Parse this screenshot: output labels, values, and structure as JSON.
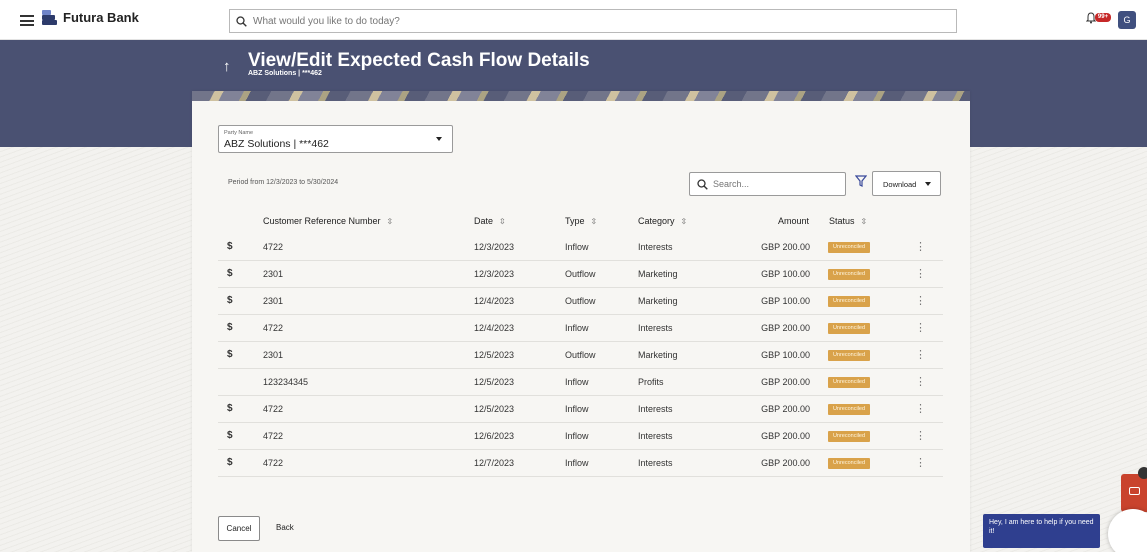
{
  "app": {
    "brand": "Futura Bank",
    "search_placeholder": "What would you like to do today?",
    "notification_badge": "99+",
    "avatar_initial": "G"
  },
  "header": {
    "title": "View/Edit Expected Cash Flow Details",
    "subtitle": "ABZ Solutions | ***462"
  },
  "filters": {
    "party_label": "Party Name",
    "party_value": "ABZ Solutions | ***462",
    "period": "Period from 12/3/2023 to 5/30/2024",
    "search_placeholder": "Search...",
    "download_label": "Download"
  },
  "table": {
    "columns": [
      "Customer Reference Number",
      "Date",
      "Type",
      "Category",
      "Amount",
      "Status"
    ],
    "rows": [
      {
        "icon": true,
        "ref": "4722",
        "date": "12/3/2023",
        "type": "Inflow",
        "category": "Interests",
        "amount": "GBP 200.00",
        "status": "Unreconciled"
      },
      {
        "icon": true,
        "ref": "2301",
        "date": "12/3/2023",
        "type": "Outflow",
        "category": "Marketing",
        "amount": "GBP 100.00",
        "status": "Unreconciled"
      },
      {
        "icon": true,
        "ref": "2301",
        "date": "12/4/2023",
        "type": "Outflow",
        "category": "Marketing",
        "amount": "GBP 100.00",
        "status": "Unreconciled"
      },
      {
        "icon": true,
        "ref": "4722",
        "date": "12/4/2023",
        "type": "Inflow",
        "category": "Interests",
        "amount": "GBP 200.00",
        "status": "Unreconciled"
      },
      {
        "icon": true,
        "ref": "2301",
        "date": "12/5/2023",
        "type": "Outflow",
        "category": "Marketing",
        "amount": "GBP 100.00",
        "status": "Unreconciled"
      },
      {
        "icon": false,
        "ref": "123234345",
        "date": "12/5/2023",
        "type": "Inflow",
        "category": "Profits",
        "amount": "GBP 200.00",
        "status": "Unreconciled"
      },
      {
        "icon": true,
        "ref": "4722",
        "date": "12/5/2023",
        "type": "Inflow",
        "category": "Interests",
        "amount": "GBP 200.00",
        "status": "Unreconciled"
      },
      {
        "icon": true,
        "ref": "4722",
        "date": "12/6/2023",
        "type": "Inflow",
        "category": "Interests",
        "amount": "GBP 200.00",
        "status": "Unreconciled"
      },
      {
        "icon": true,
        "ref": "4722",
        "date": "12/7/2023",
        "type": "Inflow",
        "category": "Interests",
        "amount": "GBP 200.00",
        "status": "Unreconciled"
      }
    ]
  },
  "actions": {
    "cancel_label": "Cancel",
    "back_label": "Back"
  },
  "chat": {
    "message": "Hey, I am here to help if you need it!"
  },
  "colors": {
    "header_band": "#4a5172",
    "status_badge": "#d9a24a",
    "chat_bubble": "#2f3f8f",
    "chat_button": "#c9432d"
  },
  "icons": [
    "menu-icon",
    "bank-logo-icon",
    "search-icon",
    "bell-icon",
    "back-arrow-icon",
    "dropdown-caret-icon",
    "filter-icon",
    "sort-icon",
    "currency-icon",
    "kebab-menu-icon",
    "chat-icon"
  ]
}
